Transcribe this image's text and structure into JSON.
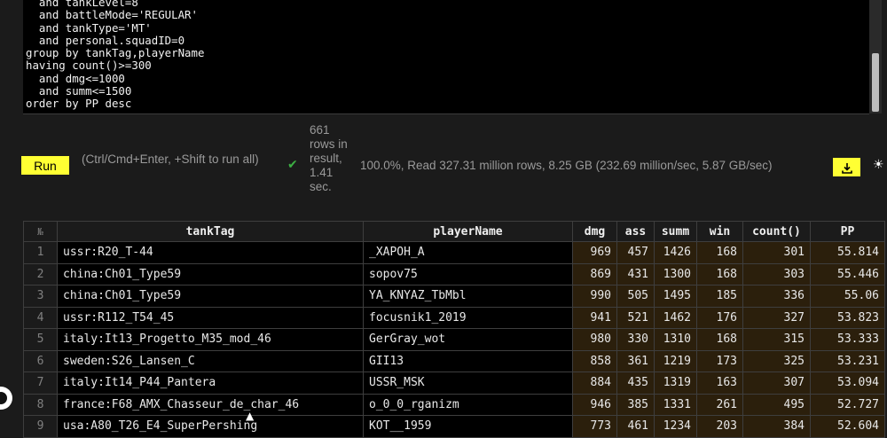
{
  "editor": {
    "lines": [
      "  and tankLevel=8",
      "  and battleMode='REGULAR'",
      "  and tankType='MT'",
      "  and personal.squadID=0",
      "group by tankTag,playerName",
      "having count()>=300",
      "  and dmg<=1000",
      "  and summ<=1500",
      "order by PP desc"
    ]
  },
  "toolbar": {
    "run_label": "Run",
    "run_hint": "(Ctrl/Cmd+Enter, +Shift to run all)",
    "success_icon": "✔",
    "rows_info": "661 rows in result, 1.41 sec.",
    "stats": "100.0%, Read 327.31 million rows, 8.25 GB (232.69 million/sec, 5.87 GB/sec)",
    "download_icon": "download-icon",
    "theme_icon": "☀"
  },
  "colors": {
    "accent": "#ffff33",
    "success": "#3cb043",
    "bar": "#2b1f0c"
  },
  "table": {
    "rownum_header": "№",
    "columns": [
      "tankTag",
      "playerName",
      "dmg",
      "ass",
      "summ",
      "win",
      "count()",
      "PP"
    ],
    "rows": [
      [
        "1",
        "ussr:R20_T-44",
        "_XAPOH_A",
        "969",
        "457",
        "1426",
        "168",
        "301",
        "55.814"
      ],
      [
        "2",
        "china:Ch01_Type59",
        "sopov75",
        "869",
        "431",
        "1300",
        "168",
        "303",
        "55.446"
      ],
      [
        "3",
        "china:Ch01_Type59",
        "YA_KNYAZ_TbMbl",
        "990",
        "505",
        "1495",
        "185",
        "336",
        "55.06"
      ],
      [
        "4",
        "ussr:R112_T54_45",
        "focusnik1_2019",
        "941",
        "521",
        "1462",
        "176",
        "327",
        "53.823"
      ],
      [
        "5",
        "italy:It13_Progetto_M35_mod_46",
        "GerGray_wot",
        "980",
        "330",
        "1310",
        "168",
        "315",
        "53.333"
      ],
      [
        "6",
        "sweden:S26_Lansen_C",
        "GII13",
        "858",
        "361",
        "1219",
        "173",
        "325",
        "53.231"
      ],
      [
        "7",
        "italy:It14_P44_Pantera",
        "USSR_MSK",
        "884",
        "435",
        "1319",
        "163",
        "307",
        "53.094"
      ],
      [
        "8",
        "france:F68_AMX_Chasseur_de_char_46",
        "o_0_0_rganizm",
        "946",
        "385",
        "1331",
        "261",
        "495",
        "52.727"
      ],
      [
        "9",
        "usa:A80_T26_E4_SuperPershing",
        "KOT__1959",
        "773",
        "461",
        "1234",
        "203",
        "384",
        "52.604"
      ]
    ]
  }
}
